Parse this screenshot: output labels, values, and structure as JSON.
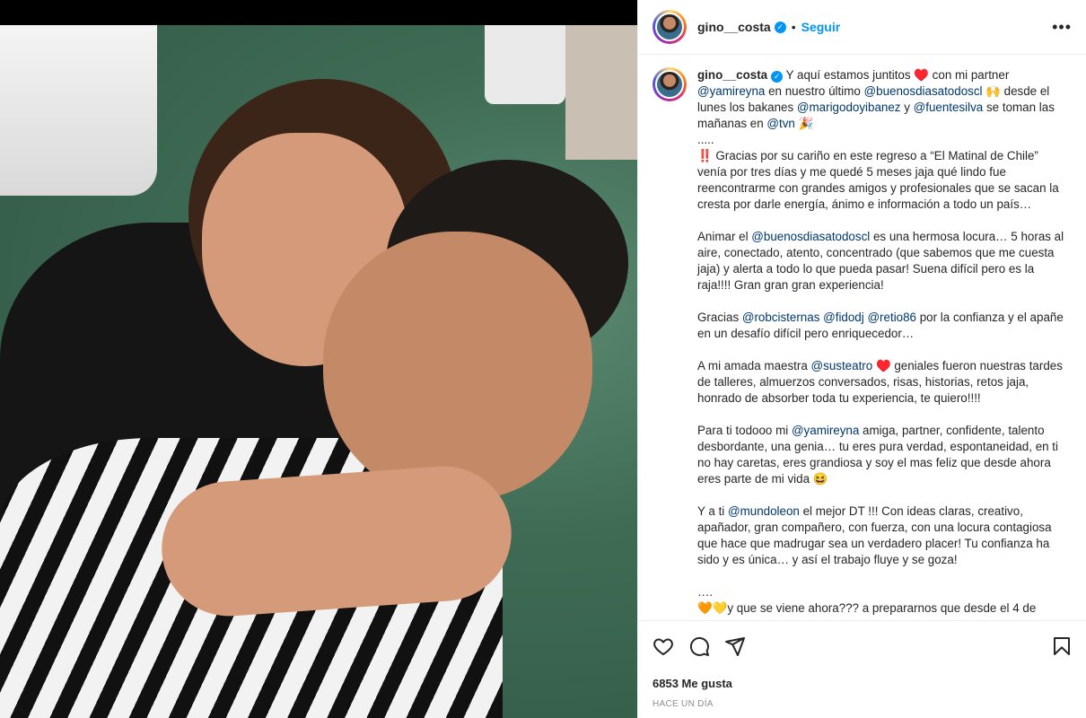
{
  "post": {
    "username": "gino__costa",
    "verified": true,
    "separator": "•",
    "follow_label": "Seguir",
    "more_label": "•••"
  },
  "caption": {
    "username": "gino__costa",
    "segments": [
      {
        "t": "text",
        "v": "Y aquí estamos juntitos ♥️ con mi partner "
      },
      {
        "t": "mention",
        "v": "@yamireyna"
      },
      {
        "t": "text",
        "v": " en nuestro último "
      },
      {
        "t": "mention",
        "v": "@buenosdiasatodoscl"
      },
      {
        "t": "text",
        "v": " 🙌 desde el lunes los bakanes "
      },
      {
        "t": "mention",
        "v": "@marigodoyibanez"
      },
      {
        "t": "text",
        "v": " y "
      },
      {
        "t": "mention",
        "v": "@fuentesilva"
      },
      {
        "t": "text",
        "v": " se toman las mañanas en "
      },
      {
        "t": "mention",
        "v": "@tvn"
      },
      {
        "t": "text",
        "v": " 🎉\n.....\n‼️ Gracias por su cariño en este regreso a “El Matinal de Chile” venía por tres días y me quedé 5 meses jaja qué lindo fue reencontrarme con grandes amigos y profesionales que se sacan la cresta por darle energía, ánimo e información a todo un país…\n\nAnimar el "
      },
      {
        "t": "mention",
        "v": "@buenosdiasatodoscl"
      },
      {
        "t": "text",
        "v": " es una hermosa locura… 5 horas al aire, conectado, atento, concentrado (que sabemos que me cuesta jaja) y alerta a todo lo que pueda pasar! Suena difícil pero es la raja!!!! Gran gran gran experiencia!\n\nGracias "
      },
      {
        "t": "mention",
        "v": "@robcisternas"
      },
      {
        "t": "text",
        "v": " "
      },
      {
        "t": "mention",
        "v": "@fidodj"
      },
      {
        "t": "text",
        "v": " "
      },
      {
        "t": "mention",
        "v": "@retio86"
      },
      {
        "t": "text",
        "v": " por la confianza y el apañe en un desafío difícil pero enriquecedor…\n\nA mi amada maestra "
      },
      {
        "t": "mention",
        "v": "@susteatro"
      },
      {
        "t": "text",
        "v": " ♥️ geniales fueron nuestras tardes de talleres, almuerzos conversados, risas, historias, retos jaja, honrado de absorber toda tu experiencia, te quiero!!!!\n\nPara ti todooo mi "
      },
      {
        "t": "mention",
        "v": "@yamireyna"
      },
      {
        "t": "text",
        "v": " amiga, partner, confidente, talento desbordante, una genia… tu eres pura verdad, espontaneidad, en ti no hay caretas, eres grandiosa y soy el mas feliz que desde ahora eres parte de mi vida 😆\n\nY a ti "
      },
      {
        "t": "mention",
        "v": "@mundoleon"
      },
      {
        "t": "text",
        "v": " el mejor DT !!! Con ideas claras, creativo, apañador, gran compañero, con fuerza, con una locura contagiosa que hace que madrugar sea un verdadero placer! Tu confianza ha sido y es única… y así el trabajo fluye y se goza!\n\n….\n🧡💛y que se viene ahora??? a prepararnos que desde el 4 de"
      }
    ]
  },
  "footer": {
    "likes": "6853 Me gusta",
    "time": "HACE UN DÍA"
  },
  "icons": {
    "like": "heart-icon",
    "comment": "comment-icon",
    "share": "share-icon",
    "save": "bookmark-icon"
  },
  "colors": {
    "accent": "#0095f6",
    "mention": "#00376b",
    "muted": "#8e8e8e"
  }
}
